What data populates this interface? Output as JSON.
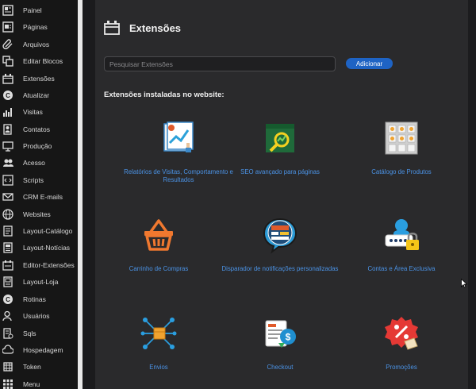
{
  "sidebar": {
    "items": [
      {
        "label": "Painel",
        "icon": "dashboard-icon"
      },
      {
        "label": "Páginas",
        "icon": "pages-icon"
      },
      {
        "label": "Arquivos",
        "icon": "paperclip-icon"
      },
      {
        "label": "Editar Blocos",
        "icon": "blocks-icon"
      },
      {
        "label": "Extensões",
        "icon": "extension-icon"
      },
      {
        "label": "Atualizar",
        "icon": "refresh-icon"
      },
      {
        "label": "Visitas",
        "icon": "bar-chart-icon"
      },
      {
        "label": "Contatos",
        "icon": "contacts-icon"
      },
      {
        "label": "Produção",
        "icon": "production-icon"
      },
      {
        "label": "Acesso",
        "icon": "users-icon"
      },
      {
        "label": "Scripts",
        "icon": "code-icon"
      },
      {
        "label": "CRM E-mails",
        "icon": "mail-icon"
      },
      {
        "label": "Websites",
        "icon": "globe-icon"
      },
      {
        "label": "Layout-Catálogo",
        "icon": "layout-icon"
      },
      {
        "label": "Layout-Notícias",
        "icon": "news-icon"
      },
      {
        "label": "Editor-Extensões",
        "icon": "editor-icon"
      },
      {
        "label": "Layout-Loja",
        "icon": "store-icon"
      },
      {
        "label": "Rotinas",
        "icon": "routine-icon"
      },
      {
        "label": "Usuários",
        "icon": "user-icon"
      },
      {
        "label": "Sqls",
        "icon": "database-icon"
      },
      {
        "label": "Hospedagem",
        "icon": "cloud-icon"
      },
      {
        "label": "Token",
        "icon": "token-icon"
      },
      {
        "label": "Menu",
        "icon": "grid-icon"
      }
    ]
  },
  "main": {
    "title": "Extensões",
    "search": {
      "placeholder": "Pesquisar Extensões",
      "value": ""
    },
    "add_label": "Adicionar",
    "section_heading": "Extensões instaladas no website:",
    "extensions": [
      {
        "label": "Relatórios de Visitas, Comportamento e Resultados",
        "icon": "visits-report-icon"
      },
      {
        "label": "SEO avançado para páginas",
        "icon": "seo-icon"
      },
      {
        "label": "Catálogo de Produtos",
        "icon": "catalog-icon"
      },
      {
        "label": "Carrinho de Compras",
        "icon": "shopping-basket-icon"
      },
      {
        "label": "Disparador de notificações personalizadas",
        "icon": "notification-icon"
      },
      {
        "label": "Contas e Área Exclusiva",
        "icon": "account-lock-icon"
      },
      {
        "label": "Envios",
        "icon": "shipping-icon"
      },
      {
        "label": "Checkout",
        "icon": "checkout-icon"
      },
      {
        "label": "Promoções",
        "icon": "promotion-icon"
      }
    ]
  },
  "colors": {
    "accent": "#1e63c4",
    "link": "#4b93e6",
    "panel": "#2a2a2c",
    "sidebar": "#161616"
  }
}
